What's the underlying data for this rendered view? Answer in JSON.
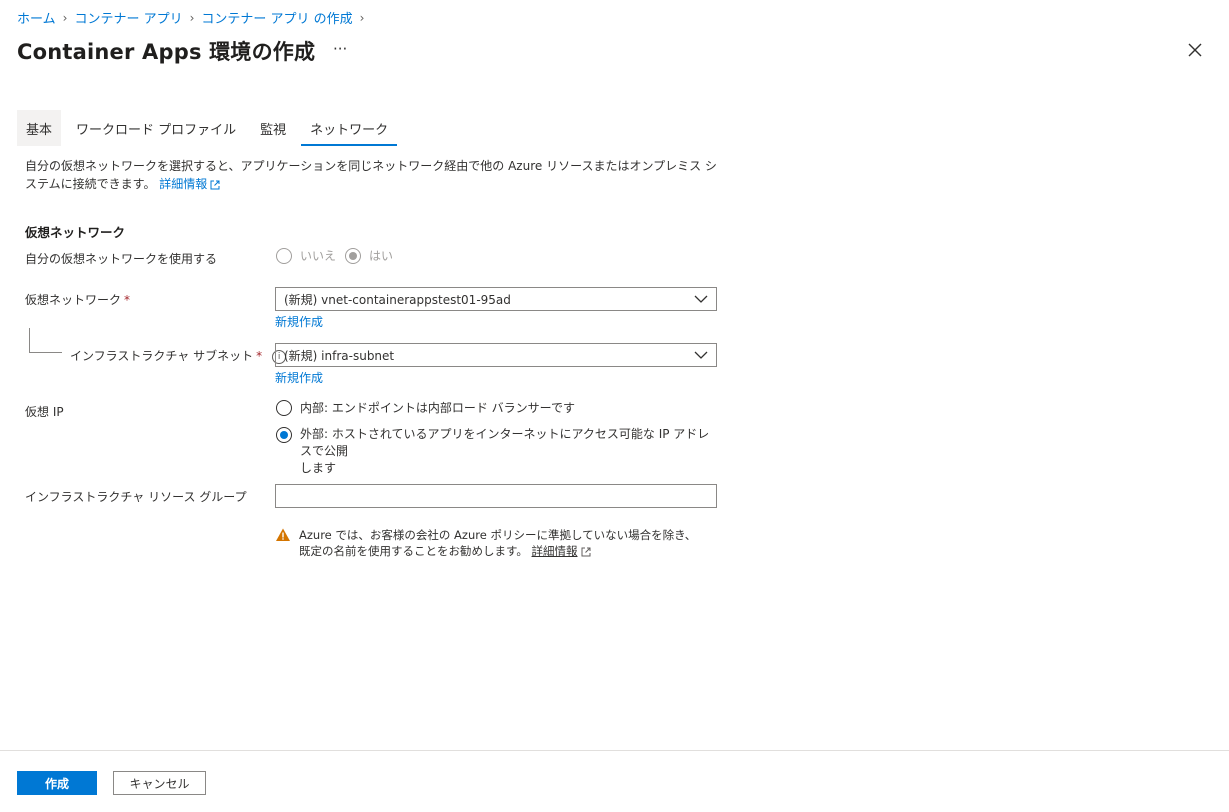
{
  "breadcrumb": {
    "items": [
      "ホーム",
      "コンテナー アプリ",
      "コンテナー アプリ の作成"
    ]
  },
  "header": {
    "title": "Container Apps 環境の作成",
    "more": "···"
  },
  "tabs": [
    {
      "label": "基本"
    },
    {
      "label": "ワークロード プロファイル"
    },
    {
      "label": "監視"
    },
    {
      "label": "ネットワーク"
    }
  ],
  "active_tab": "ネットワーク",
  "description": {
    "text": "自分の仮想ネットワークを選択すると、アプリケーションを同じネットワーク経由で他の Azure リソースまたはオンプレミス システムに接続できます。",
    "link": "詳細情報"
  },
  "vnet_section": {
    "title": "仮想ネットワーク",
    "use_own_label": "自分の仮想ネットワークを使用する",
    "option_no": "いいえ",
    "option_yes": "はい",
    "selected_option": "はい",
    "vnet_label": "仮想ネットワーク",
    "vnet_value": "(新規) vnet-containerappstest01-95ad",
    "vnet_new": "新規作成",
    "subnet_label": "インフラストラクチャ サブネット",
    "subnet_value": "(新規) infra-subnet",
    "subnet_new": "新規作成",
    "required_mark": "*",
    "info_glyph": "i"
  },
  "virtual_ip": {
    "label": "仮想 IP",
    "internal": "内部: エンドポイントは内部ロード バランサーです",
    "external_line1": "外部: ホストされているアプリをインターネットにアクセス可能な IP アドレスで公開",
    "external_line2": "します",
    "selected": "external"
  },
  "infra_rg": {
    "label": "インフラストラクチャ リソース グループ",
    "value": "",
    "warning": "Azure では、お客様の会社の Azure ポリシーに準拠していない場合を除き、既定の名前を使用することをお勧めします。",
    "warning_link": "詳細情報"
  },
  "footer": {
    "create": "作成",
    "cancel": "キャンセル"
  },
  "colors": {
    "accent": "#0078d4",
    "required": "#a4262c",
    "warning": "#d47500"
  },
  "icons": {
    "close": "close-icon",
    "chevron": "chevron-down-icon",
    "external": "external-link-icon",
    "info": "info-icon",
    "warning": "warning-icon"
  }
}
